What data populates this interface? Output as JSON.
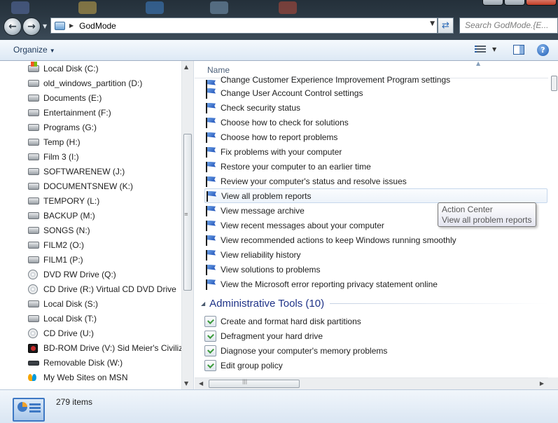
{
  "window": {
    "address_path": "GodMode",
    "search_placeholder": "Search GodMode.{E..."
  },
  "toolbar": {
    "organize_label": "Organize"
  },
  "nav": {
    "drives": [
      {
        "label": "Local Disk (C:)",
        "icon": "system-drive-icon"
      },
      {
        "label": "old_windows_partition (D:)",
        "icon": "hard-drive-icon"
      },
      {
        "label": "Documents (E:)",
        "icon": "hard-drive-icon"
      },
      {
        "label": "Entertainment (F:)",
        "icon": "hard-drive-icon"
      },
      {
        "label": "Programs (G:)",
        "icon": "hard-drive-icon"
      },
      {
        "label": "Temp (H:)",
        "icon": "hard-drive-icon"
      },
      {
        "label": "Film 3 (I:)",
        "icon": "hard-drive-icon"
      },
      {
        "label": "SOFTWARENEW (J:)",
        "icon": "hard-drive-icon"
      },
      {
        "label": "DOCUMENTSNEW (K:)",
        "icon": "hard-drive-icon"
      },
      {
        "label": "TEMPORY (L:)",
        "icon": "hard-drive-icon"
      },
      {
        "label": "BACKUP (M:)",
        "icon": "hard-drive-icon"
      },
      {
        "label": "SONGS (N:)",
        "icon": "hard-drive-icon"
      },
      {
        "label": "FILM2 (O:)",
        "icon": "hard-drive-icon"
      },
      {
        "label": "FILM1 (P:)",
        "icon": "hard-drive-icon"
      },
      {
        "label": "DVD RW Drive (Q:)",
        "icon": "optical-drive-icon"
      },
      {
        "label": "CD Drive (R:) Virtual CD DVD Drive",
        "icon": "virtual-cd-icon"
      },
      {
        "label": "Local Disk (S:)",
        "icon": "hard-drive-icon"
      },
      {
        "label": "Local Disk (T:)",
        "icon": "hard-drive-icon"
      },
      {
        "label": "CD Drive (U:)",
        "icon": "optical-drive-icon"
      },
      {
        "label": "BD-ROM Drive (V:) Sid Meier's Civilization",
        "icon": "bd-rom-icon"
      },
      {
        "label": "Removable Disk (W:)",
        "icon": "removable-disk-icon"
      },
      {
        "label": "My Web Sites on MSN",
        "icon": "msn-icon"
      }
    ]
  },
  "content": {
    "column_name": "Name",
    "partial_item": "Change Customer Experience Improvement Program settings",
    "action_center_items": [
      "Change User Account Control settings",
      "Check security status",
      "Choose how to check for solutions",
      "Choose how to report problems",
      "Fix problems with your computer",
      "Restore your computer to an earlier time",
      "Review your computer's status and resolve issues",
      "View all problem reports",
      "View message archive",
      "View recent messages about your computer",
      "View recommended actions to keep Windows running smoothly",
      "View reliability history",
      "View solutions to problems",
      "View the Microsoft error reporting privacy statement online"
    ],
    "admin_group_title": "Administrative Tools (10)",
    "admin_items": [
      "Create and format hard disk partitions",
      "Defragment your hard drive",
      "Diagnose your computer's memory problems",
      "Edit group policy"
    ],
    "hovered_item": "View all problem reports"
  },
  "tooltip": {
    "line1": "Action Center",
    "line2": "View all problem reports"
  },
  "status": {
    "item_count": "279 items"
  }
}
